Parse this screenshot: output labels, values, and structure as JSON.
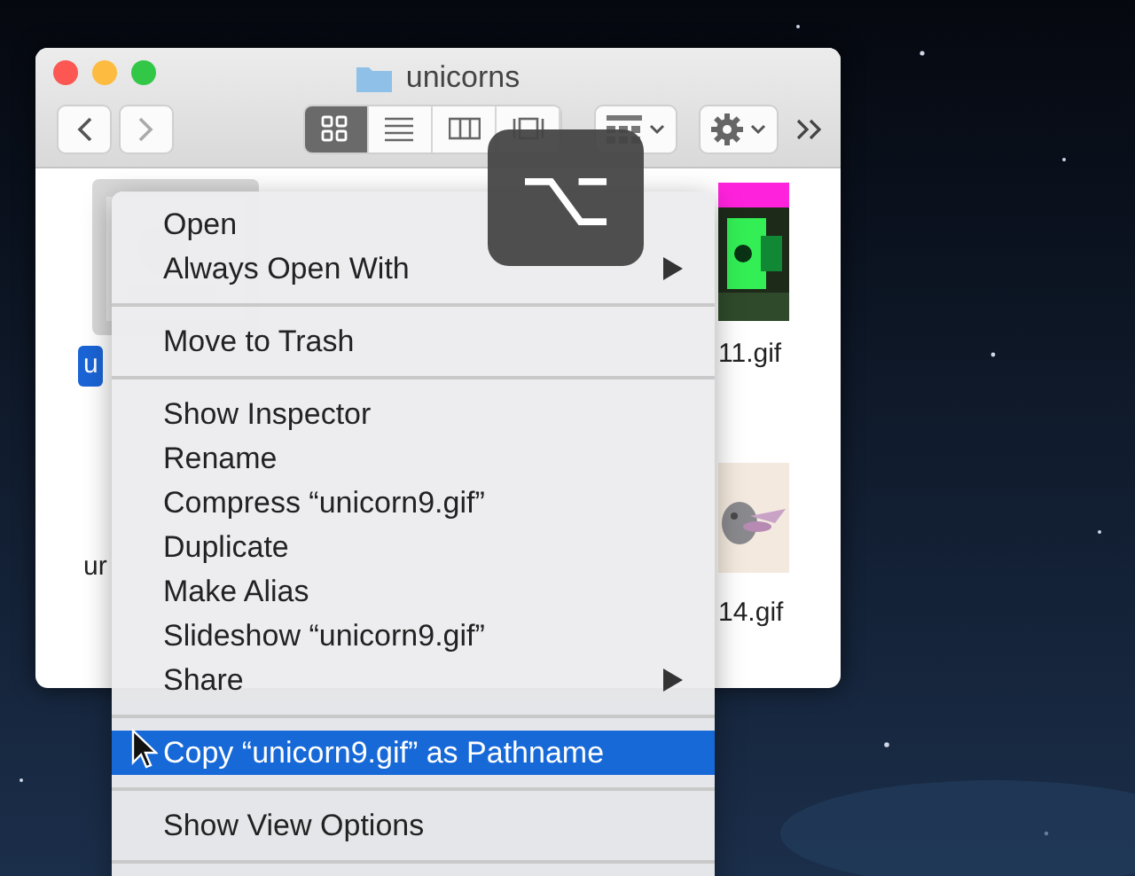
{
  "window": {
    "title": "unicorns"
  },
  "toolbar": {
    "view_modes": [
      {
        "kind": "icons",
        "selected": true
      },
      {
        "kind": "list",
        "selected": false
      },
      {
        "kind": "columns",
        "selected": false
      },
      {
        "kind": "gallery",
        "selected": false
      }
    ]
  },
  "files": [
    {
      "name": "u",
      "selected": true
    },
    {
      "name": "11.gif",
      "selected": false
    },
    {
      "name": "ur",
      "selected": false
    },
    {
      "name": "14.gif",
      "selected": false
    }
  ],
  "context_menu": {
    "items": [
      {
        "kind": "item",
        "label": "Open",
        "submenu": false,
        "highlighted": false
      },
      {
        "kind": "item",
        "label": "Always Open With",
        "submenu": true,
        "highlighted": false
      },
      {
        "kind": "separator"
      },
      {
        "kind": "item",
        "label": "Move to Trash",
        "submenu": false,
        "highlighted": false
      },
      {
        "kind": "separator"
      },
      {
        "kind": "item",
        "label": "Show Inspector",
        "submenu": false,
        "highlighted": false
      },
      {
        "kind": "item",
        "label": "Rename",
        "submenu": false,
        "highlighted": false
      },
      {
        "kind": "item",
        "label": "Compress “unicorn9.gif”",
        "submenu": false,
        "highlighted": false
      },
      {
        "kind": "item",
        "label": "Duplicate",
        "submenu": false,
        "highlighted": false
      },
      {
        "kind": "item",
        "label": "Make Alias",
        "submenu": false,
        "highlighted": false
      },
      {
        "kind": "item",
        "label": "Slideshow “unicorn9.gif”",
        "submenu": false,
        "highlighted": false
      },
      {
        "kind": "item",
        "label": "Share",
        "submenu": true,
        "highlighted": false
      },
      {
        "kind": "separator"
      },
      {
        "kind": "item",
        "label": "Copy “unicorn9.gif” as Pathname",
        "submenu": false,
        "highlighted": true
      },
      {
        "kind": "separator"
      },
      {
        "kind": "item",
        "label": "Show View Options",
        "submenu": false,
        "highlighted": false
      },
      {
        "kind": "separator"
      }
    ]
  },
  "key_hud": {
    "symbol": "⌥"
  }
}
